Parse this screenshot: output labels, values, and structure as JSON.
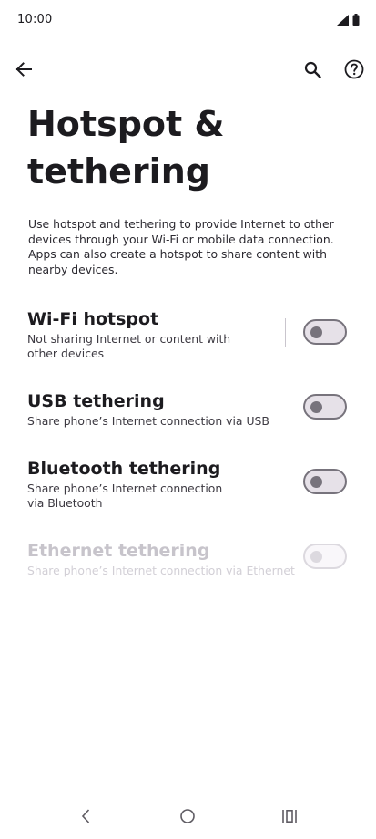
{
  "status_bar": {
    "time": "10:00",
    "icons": [
      "signal-icon",
      "battery-icon"
    ]
  },
  "app_bar": {
    "back_icon": "arrow-back-icon",
    "search_icon": "search-icon",
    "help_icon": "help-icon"
  },
  "page": {
    "title": "Hotspot & tethering",
    "description": "Use hotspot and tethering to provide Internet to other devices through your Wi-Fi or mobile data connection. Apps can also create a hotspot to share content with nearby devices."
  },
  "preferences": [
    {
      "title": "Wi-Fi hotspot",
      "summary": "Not sharing Internet or content with other devices",
      "enabled": true,
      "checked": false
    },
    {
      "title": "USB tethering",
      "summary": "Share phone’s Internet connection via USB",
      "enabled": true,
      "checked": false
    },
    {
      "title": "Bluetooth tethering",
      "summary": "Share phone’s Internet connection via Bluetooth",
      "enabled": true,
      "checked": false
    },
    {
      "title": "Ethernet tethering",
      "summary": "Share phone’s Internet connection via Ethernet",
      "enabled": false,
      "checked": false
    }
  ],
  "nav_bar": {
    "icons": [
      "nav-back-icon",
      "nav-home-icon",
      "nav-recents-icon"
    ]
  },
  "colors": {
    "background": "#ffffff",
    "text_primary": "#1c1b1f",
    "toggle_outline": "#77737c",
    "toggle_track": "#e6e1e8",
    "disabled_text": "#c7c4cb"
  }
}
